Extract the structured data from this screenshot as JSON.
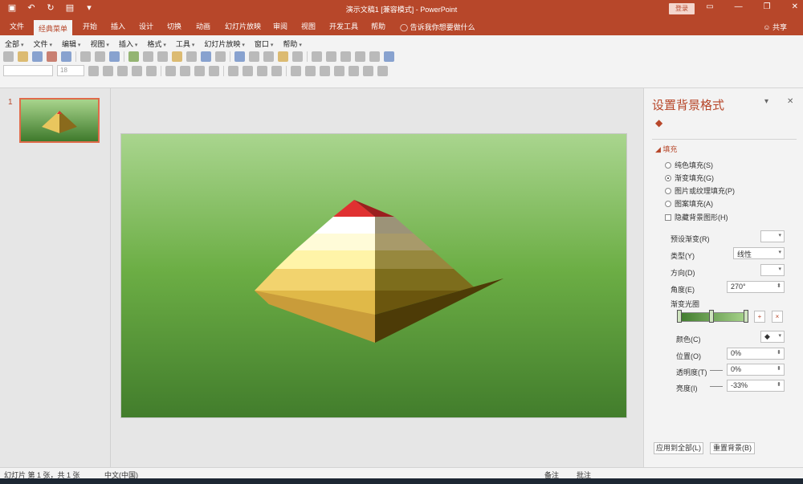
{
  "window": {
    "title": "演示文稿1 [兼容模式] - PowerPoint",
    "login_label": "登录",
    "brand_color": "#b7472a"
  },
  "ribbon": {
    "tabs": [
      "文件",
      "经典菜单",
      "开始",
      "插入",
      "设计",
      "切换",
      "动画",
      "幻灯片放映",
      "审阅",
      "视图",
      "开发工具",
      "帮助"
    ],
    "active_tab": "经典菜单",
    "tell_me": "告诉我你想要做什么",
    "share": "共享"
  },
  "classic_menus": [
    "全部",
    "文件",
    "编辑",
    "视图",
    "插入",
    "格式",
    "工具",
    "幻灯片放映",
    "窗口",
    "帮助"
  ],
  "font_combo": {
    "font_size": "18"
  },
  "thumbnails": {
    "number": "1"
  },
  "format_pane": {
    "title": "设置背景格式",
    "section": "填充",
    "fill_options": [
      {
        "label": "纯色填充(S)",
        "selected": false
      },
      {
        "label": "渐变填充(G)",
        "selected": true
      },
      {
        "label": "图片或纹理填充(P)",
        "selected": false
      },
      {
        "label": "图案填充(A)",
        "selected": false
      }
    ],
    "hide_bg_graphics": "隐藏背景图形(H)",
    "preset_label": "预设渐变(R)",
    "type_label": "类型(Y)",
    "type_value": "线性",
    "direction_label": "方向(D)",
    "angle_label": "角度(E)",
    "angle_value": "270°",
    "stops_label": "渐变光圈",
    "color_label": "颜色(C)",
    "position_label": "位置(O)",
    "position_value": "0%",
    "transparency_label": "透明度(T)",
    "transparency_value": "0%",
    "brightness_label": "亮度(I)",
    "brightness_value": "-33%",
    "apply_all": "应用到全部(L)",
    "reset": "重置背景(B)"
  },
  "status_bar": {
    "slide_info": "幻灯片 第 1 张，共 1 张",
    "language": "中文(中国)",
    "notes": "备注",
    "comments": "批注"
  }
}
